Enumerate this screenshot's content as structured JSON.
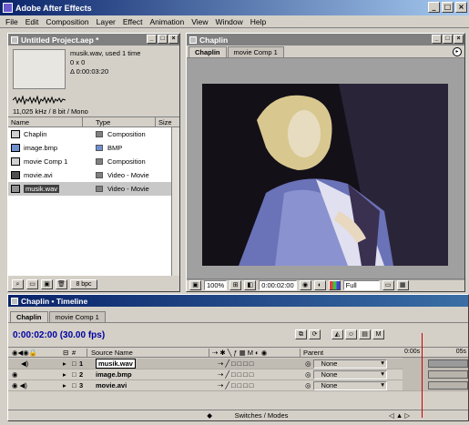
{
  "app": {
    "title": "Adobe After Effects"
  },
  "menu": [
    "File",
    "Edit",
    "Composition",
    "Layer",
    "Effect",
    "Animation",
    "View",
    "Window",
    "Help"
  ],
  "project": {
    "title": "Untitled Project.aep *",
    "selected_name": "musik.wav",
    "used": ", used 1 time",
    "dims": "0 x 0",
    "duration": "Δ 0:00:03:20",
    "audio_info": "11,025 kHz / 8 bit / Mono",
    "columns": [
      "Name",
      "Type",
      "Size"
    ],
    "items": [
      {
        "name": "Chaplin",
        "type": "Composition",
        "icon": "composition-icon",
        "label_color": "#808080"
      },
      {
        "name": "image.bmp",
        "type": "BMP",
        "icon": "image-file-icon",
        "label_color": "#7090d0"
      },
      {
        "name": "movie Comp 1",
        "type": "Composition",
        "icon": "composition-icon",
        "label_color": "#808080"
      },
      {
        "name": "movie.avi",
        "type": "Video - Movie",
        "icon": "video-file-icon",
        "label_color": "#808080"
      },
      {
        "name": "musik.wav",
        "type": "Video - Movie",
        "icon": "audio-file-icon",
        "label_color": "#808080"
      }
    ],
    "bpc": "8 bpc"
  },
  "comp": {
    "title": "Chaplin",
    "tabs": [
      "Chaplin",
      "movie Comp 1"
    ],
    "zoom": "100%",
    "timecode": "0:00:02:00",
    "resolution": "Full"
  },
  "timeline": {
    "title": "Chaplin • Timeline",
    "tabs": [
      "Chaplin",
      "movie Comp 1"
    ],
    "current_time": "0:00:02:00",
    "fps": "(30.00 fps)",
    "headers": {
      "num": "#",
      "source": "Source Name",
      "parent": "Parent"
    },
    "ruler": [
      "0:00s",
      "05s"
    ],
    "layers": [
      {
        "num": "1",
        "name": "musik.wav",
        "parent": "None",
        "icon": "audio-file-icon"
      },
      {
        "num": "2",
        "name": "image.bmp",
        "parent": "None",
        "icon": "image-file-icon"
      },
      {
        "num": "3",
        "name": "movie.avi",
        "parent": "None",
        "icon": "video-file-icon"
      }
    ],
    "footer": "Switches / Modes"
  }
}
